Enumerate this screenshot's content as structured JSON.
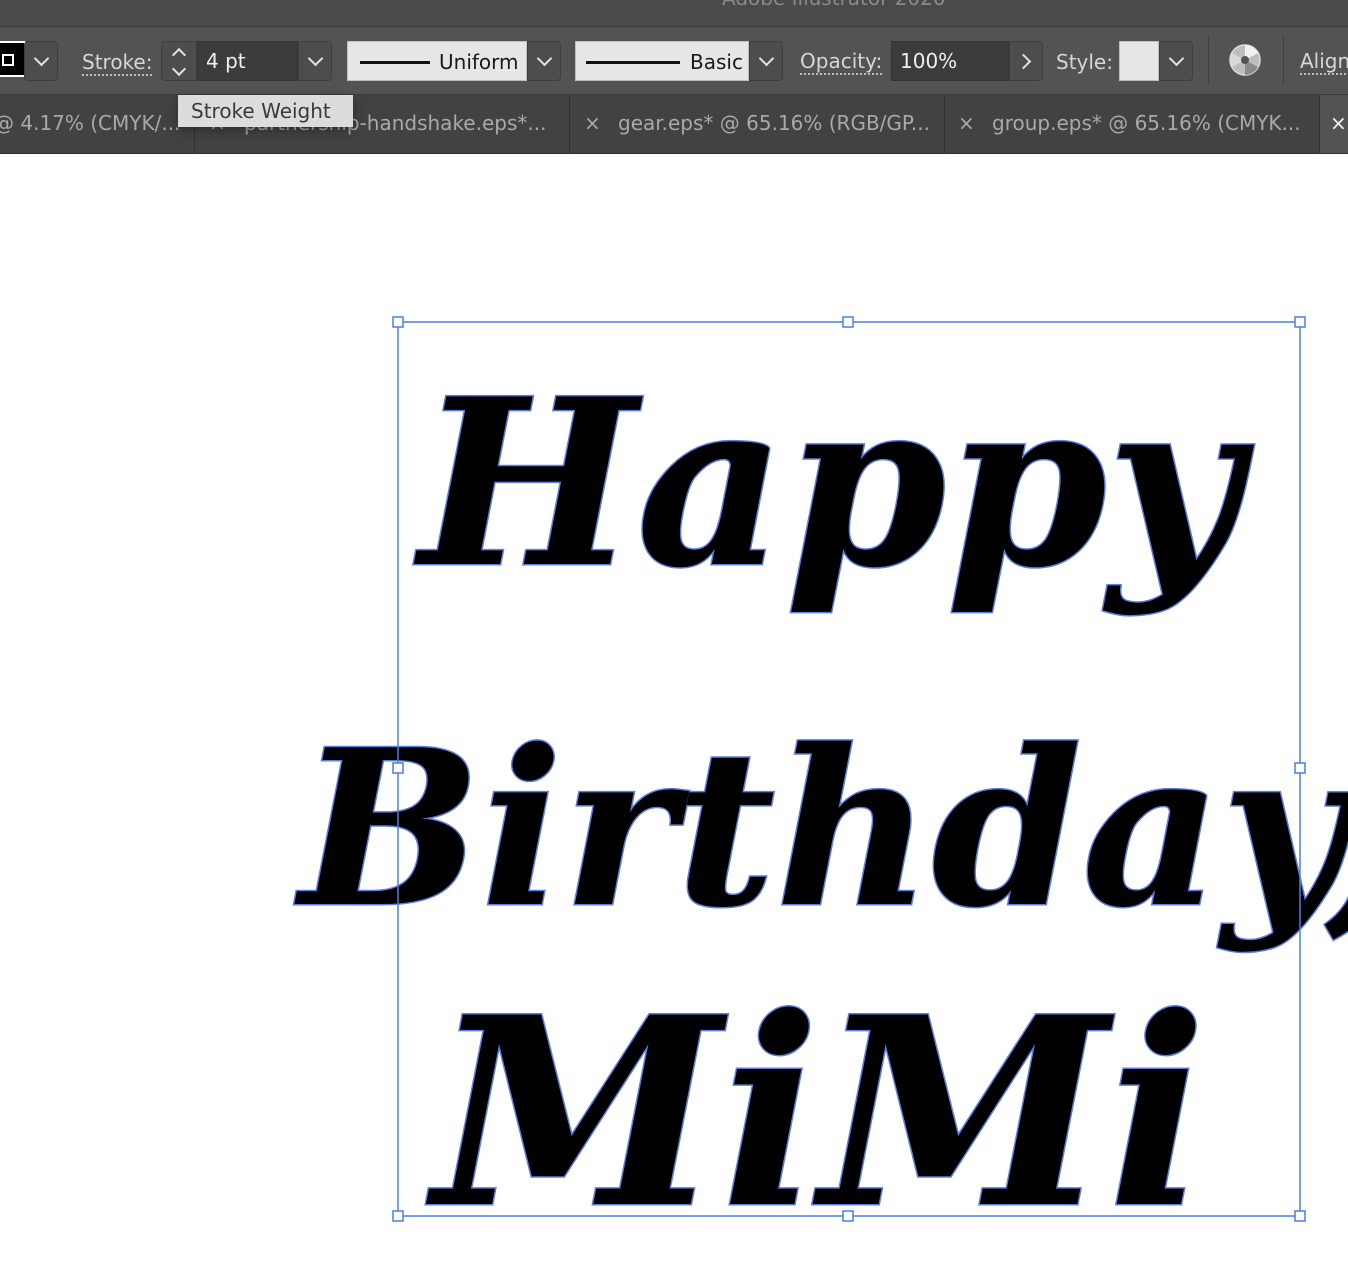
{
  "window": {
    "title": "Adobe Illustrator 2020"
  },
  "control_bar": {
    "stroke_label": "Stroke:",
    "stroke_weight": "4 pt",
    "variable_width_profile": "Uniform",
    "brush_definition": "Basic",
    "opacity_label": "Opacity:",
    "opacity_value": "100%",
    "style_label": "Style:",
    "align_label": "Align"
  },
  "tooltip": {
    "text": "Stroke Weight"
  },
  "tabs": [
    {
      "label": "@ 4.17% (CMYK/...",
      "active": false
    },
    {
      "label": "partnership-handshake.eps*...",
      "active": false
    },
    {
      "label": "gear.eps* @ 65.16% (RGB/GP...",
      "active": false
    },
    {
      "label": "group.eps* @ 65.16% (CMYK...",
      "active": false
    },
    {
      "label": "",
      "active": true
    }
  ],
  "artwork": {
    "lines": [
      "Happy",
      "Birthday,",
      "MiMi"
    ],
    "fill_color": "#000000",
    "outline_color": "#5b7ee5",
    "selection_color": "#4a7fe0"
  }
}
